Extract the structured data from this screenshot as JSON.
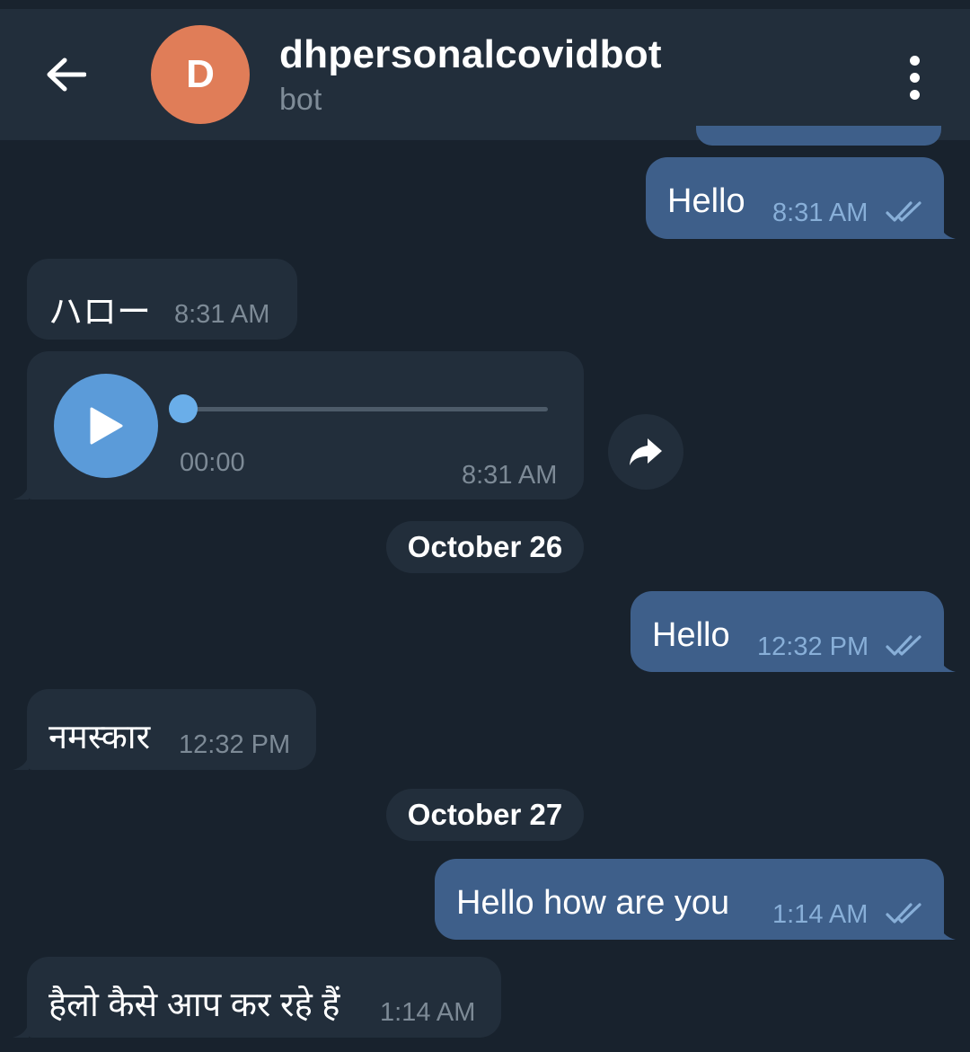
{
  "header": {
    "avatar_letter": "D",
    "avatar_color": "#e07d58",
    "title": "dhpersonalcovidbot",
    "subtitle": "bot",
    "back_icon": "arrow-left-icon",
    "menu_icon": "more-vertical-icon"
  },
  "messages": [
    {
      "direction": "out",
      "text": "Hello",
      "time": "8:31 AM",
      "read": true
    },
    {
      "direction": "in",
      "text": "ハロー",
      "time": "8:31 AM"
    },
    {
      "direction": "in",
      "type": "voice",
      "duration": "00:00",
      "time": "8:31 AM",
      "progress": 0
    },
    {
      "type": "date",
      "text": "October 26"
    },
    {
      "direction": "out",
      "text": "Hello",
      "time": "12:32 PM",
      "read": true
    },
    {
      "direction": "in",
      "text": "नमस्कार",
      "time": "12:32 PM"
    },
    {
      "type": "date",
      "text": "October 27"
    },
    {
      "direction": "out",
      "text": "Hello how are you",
      "time": "1:14 AM",
      "read": true
    },
    {
      "direction": "in",
      "text": "हैलो कैसे आप कर रहे हैं",
      "time": "1:14 AM"
    }
  ],
  "colors": {
    "background": "#18222d",
    "header": "#222e3b",
    "outgoing_bubble": "#3e5f8a",
    "incoming_bubble": "#222e3b",
    "accent": "#5b9bd9",
    "read_checks": "#88afd8"
  }
}
